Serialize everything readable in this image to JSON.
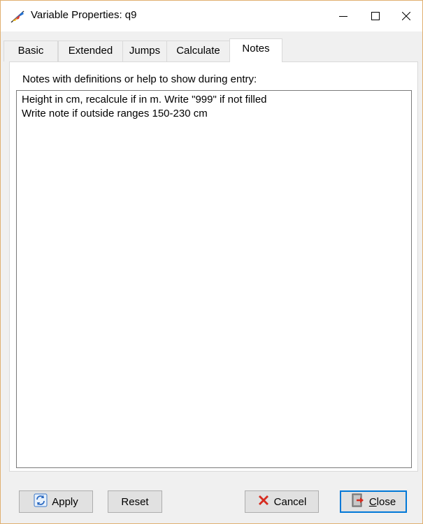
{
  "window": {
    "title": "Variable Properties: q9",
    "icon": "app-feather-icon"
  },
  "titlebar": {
    "minimize_icon": "minimize-icon",
    "maximize_icon": "maximize-icon",
    "close_icon": "close-icon"
  },
  "tabs": [
    {
      "label": "Basic",
      "active": false
    },
    {
      "label": "Extended",
      "active": false
    },
    {
      "label": "Jumps",
      "active": false
    },
    {
      "label": "Calculate",
      "active": false
    },
    {
      "label": "Notes",
      "active": true
    }
  ],
  "notes": {
    "label": "Notes with definitions or help to show during entry:",
    "lines": [
      "Height in cm, recalcule if in m. Write \"999\" if not filled",
      "Write note if outside ranges 150-230 cm"
    ]
  },
  "buttons": {
    "apply": {
      "label": "Apply",
      "icon": "refresh-icon"
    },
    "reset": {
      "label": "Reset"
    },
    "cancel": {
      "label": "Cancel",
      "icon": "red-x-icon"
    },
    "close": {
      "label_accel": "C",
      "label_rest": "lose",
      "icon": "exit-door-icon"
    }
  },
  "colors": {
    "accent": "#0078d7",
    "cancel_red": "#d62b1f"
  }
}
